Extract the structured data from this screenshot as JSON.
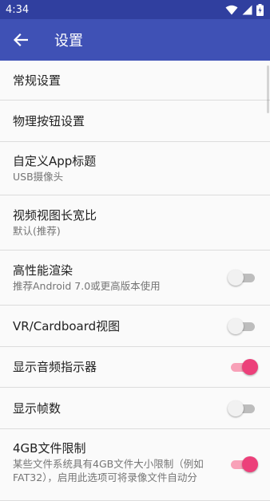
{
  "statusbar": {
    "time": "4:34"
  },
  "toolbar": {
    "title": "设置",
    "back_icon": "arrow-left-icon"
  },
  "colors": {
    "status_bar": "#303f9f",
    "app_bar": "#3f51b5",
    "switch_on": "#ec407a",
    "switch_off": "#bdbdbd"
  },
  "settings": [
    {
      "title": "常规设置"
    },
    {
      "title": "物理按钮设置"
    },
    {
      "title": "自定义App标题",
      "summary": "USB摄像头"
    },
    {
      "title": "视频视图长宽比",
      "summary": "默认(推荐)"
    },
    {
      "title": "高性能渲染",
      "summary": "推荐Android 7.0或更高版本使用",
      "switch_on": false
    },
    {
      "title": "VR/Cardboard视图",
      "switch_on": false
    },
    {
      "title": "显示音频指示器",
      "switch_on": true
    },
    {
      "title": "显示帧数",
      "switch_on": false
    },
    {
      "title": "4GB文件限制",
      "summary": "某些文件系统具有4GB文件大小限制（例如FAT32），启用此选项可将录像文件自动分",
      "switch_on": true
    }
  ]
}
